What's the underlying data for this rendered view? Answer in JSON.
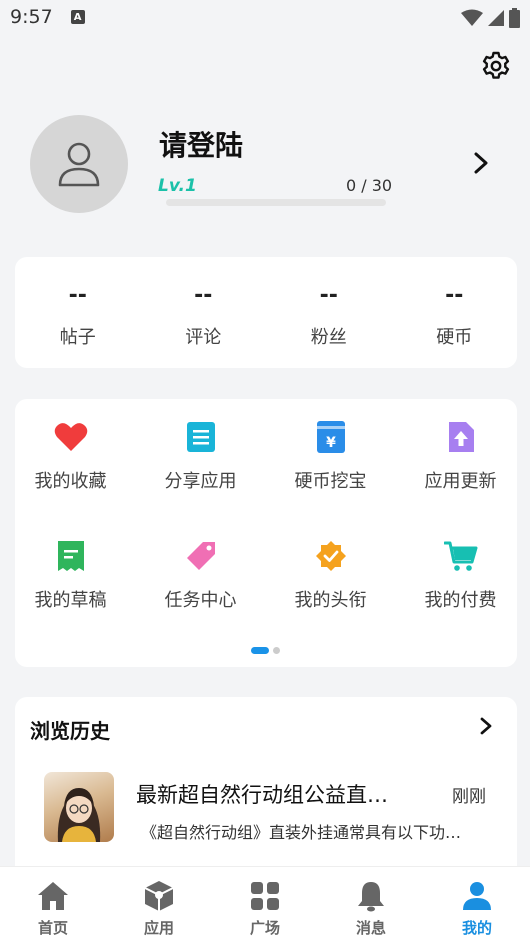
{
  "status_bar": {
    "time": "9:57",
    "notif_glyph": "A"
  },
  "profile": {
    "name": "请登陆",
    "level": "Lv.1",
    "exp_text": "0 / 30",
    "exp_progress": 0
  },
  "stats": [
    {
      "value": "--",
      "label": "帖子"
    },
    {
      "value": "--",
      "label": "评论"
    },
    {
      "value": "--",
      "label": "粉丝"
    },
    {
      "value": "--",
      "label": "硬币"
    }
  ],
  "grid": {
    "items": [
      {
        "label": "我的收藏",
        "icon": "heart-icon",
        "color": "#f03c3c"
      },
      {
        "label": "分享应用",
        "icon": "document-icon",
        "color": "#19b4d8"
      },
      {
        "label": "硬币挖宝",
        "icon": "treasure-icon",
        "color": "#2a8de8"
      },
      {
        "label": "应用更新",
        "icon": "upload-icon",
        "color": "#a77ff0"
      },
      {
        "label": "我的草稿",
        "icon": "draft-icon",
        "color": "#2fb55c"
      },
      {
        "label": "任务中心",
        "icon": "tag-icon",
        "color": "#f06fb4"
      },
      {
        "label": "我的头衔",
        "icon": "badge-icon",
        "color": "#f5a21e"
      },
      {
        "label": "我的付费",
        "icon": "cart-icon",
        "color": "#17bfb2"
      }
    ],
    "page_count": 2,
    "current_page": 1
  },
  "history": {
    "title": "浏览历史",
    "items": [
      {
        "title": "最新超自然行动组公益直…",
        "time": "刚刚",
        "desc": "《超自然行动组》直装外挂通常具有以下功…"
      }
    ]
  },
  "tabbar": {
    "tabs": [
      {
        "label": "首页",
        "icon": "home-icon"
      },
      {
        "label": "应用",
        "icon": "box-icon"
      },
      {
        "label": "广场",
        "icon": "grid-icon"
      },
      {
        "label": "消息",
        "icon": "bell-icon"
      },
      {
        "label": "我的",
        "icon": "person-icon"
      }
    ],
    "active": 4
  },
  "colors": {
    "accent": "#1a8fe0",
    "level": "#1bc1a9",
    "background": "#f3f4f6"
  }
}
